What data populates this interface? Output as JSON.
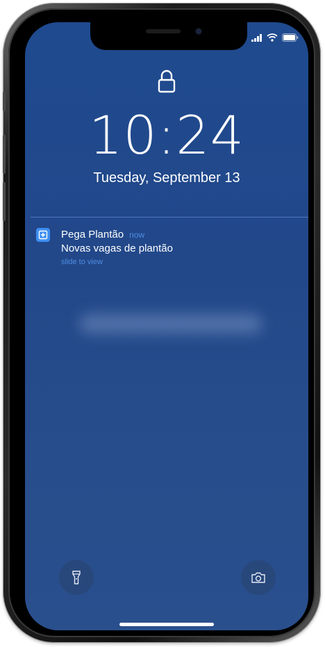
{
  "status_bar": {
    "signal_icon": "cellular-signal-icon",
    "wifi_icon": "wifi-icon",
    "battery_icon": "battery-icon"
  },
  "lock_screen": {
    "lock_icon": "lock-icon",
    "time": "10:24",
    "date": "Tuesday, September 13"
  },
  "notification": {
    "app_icon": "app-plus-icon",
    "app_name": "Pega Plantão",
    "time": "now",
    "message": "Novas vagas de plantão",
    "hint": "slide to view"
  },
  "quick_actions": {
    "flashlight_icon": "flashlight-icon",
    "camera_icon": "camera-icon"
  },
  "colors": {
    "wallpaper": "#22488a",
    "accent": "#4f8de0",
    "app_icon": "#3f8ff2",
    "text": "#ffffff"
  }
}
